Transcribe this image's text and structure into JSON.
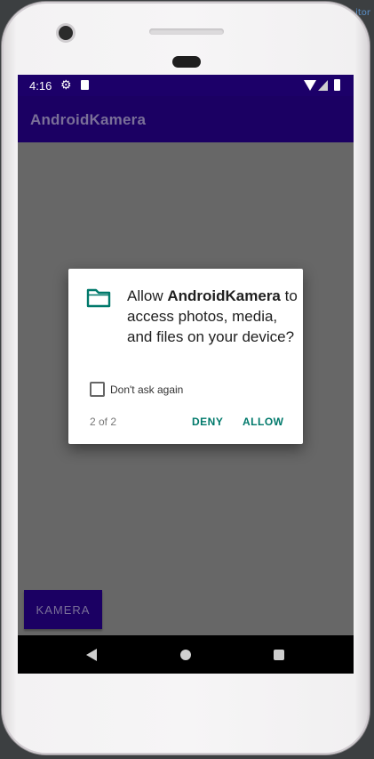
{
  "editor_tag": "itor",
  "status_bar": {
    "time": "4:16",
    "icons": [
      "gear-icon",
      "sd-card-icon",
      "wifi-icon",
      "signal-icon",
      "battery-icon"
    ]
  },
  "app_bar": {
    "title": "AndroidKamera"
  },
  "dialog": {
    "icon": "folder-icon",
    "message_prefix": "Allow ",
    "app_name": "AndroidKamera",
    "message_suffix": " to access photos, media, and files on your device?",
    "checkbox_label": "Don't ask again",
    "checkbox_checked": false,
    "pager": "2 of 2",
    "deny_label": "DENY",
    "allow_label": "ALLOW"
  },
  "main": {
    "kamera_button_label": "KAMERA"
  },
  "navigation": {
    "icons": [
      "back-icon",
      "home-icon",
      "recents-icon"
    ]
  },
  "colors": {
    "primary_dark": "#1c0069",
    "primary": "#1b0063",
    "accent": "#00796b",
    "scrim": "#676767"
  }
}
